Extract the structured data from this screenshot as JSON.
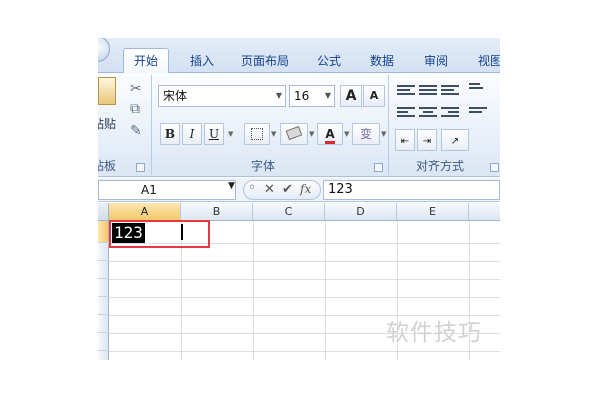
{
  "tabs": [
    "开始",
    "插入",
    "页面布局",
    "公式",
    "数据",
    "审阅",
    "视图"
  ],
  "active_tab": 0,
  "clipboard": {
    "paste_label": "贴贴",
    "group_label": "贴板"
  },
  "font": {
    "name": "宋体",
    "size": "16",
    "grow_label": "A",
    "shrink_label": "A",
    "bold": "B",
    "italic": "I",
    "underline": "U",
    "color_label": "A",
    "wen": "变",
    "group_label": "字体",
    "accent_color": "#e0282c"
  },
  "alignment": {
    "group_label": "对齐方式"
  },
  "formula_bar": {
    "name_box": "A1",
    "cancel": "✕",
    "confirm": "✔",
    "fx": "fx",
    "content": "123"
  },
  "columns": [
    "A",
    "B",
    "C",
    "D",
    "E"
  ],
  "cells": {
    "A1": "123"
  },
  "watermark": "软件技巧"
}
